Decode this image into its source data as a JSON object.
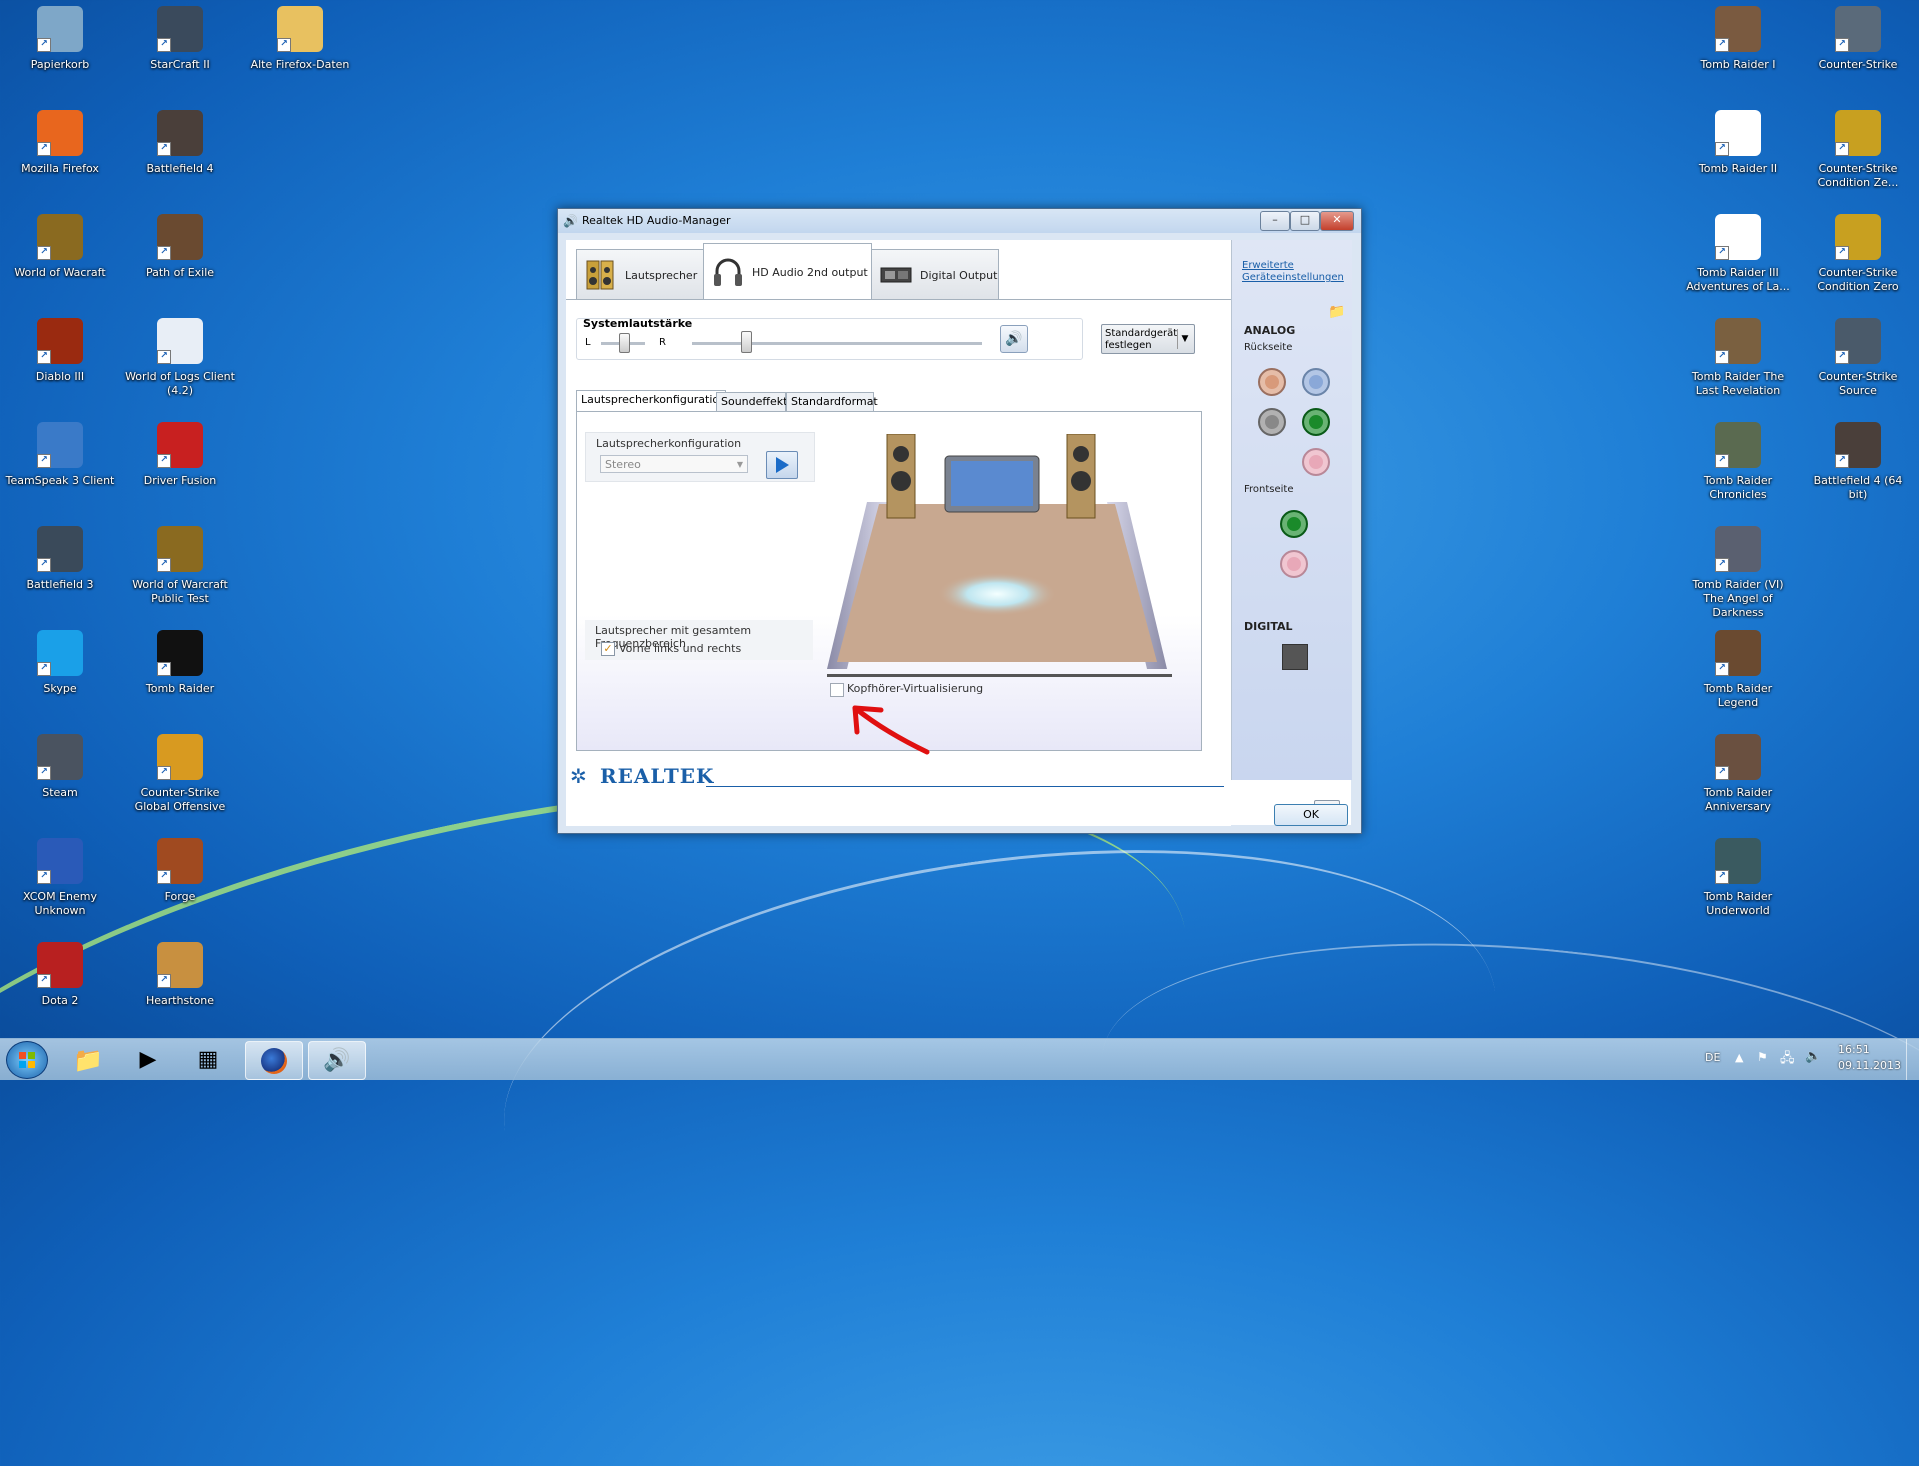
{
  "desktop": {
    "left_icons": [
      {
        "label": "Papierkorb",
        "icon": "recycle-bin-icon",
        "color": "#7ea7c8"
      },
      {
        "label": "StarCraft II",
        "icon": "starcraft-icon",
        "color": "#3a4a5c"
      },
      {
        "label": "Alte Firefox-Daten",
        "icon": "folder-icon",
        "color": "#e8c160"
      },
      {
        "label": "Mozilla Firefox",
        "icon": "firefox-icon",
        "color": "#e8661e"
      },
      {
        "label": "Battlefield 4",
        "icon": "battlefield4-icon",
        "color": "#4a3f3a"
      },
      {
        "label": "World of Wacraft",
        "icon": "warcraft-icon",
        "color": "#8a6a20"
      },
      {
        "label": "Path of Exile",
        "icon": "path-of-exile-icon",
        "color": "#6a4a30"
      },
      {
        "label": "Diablo III",
        "icon": "diablo-icon",
        "color": "#9a2a10"
      },
      {
        "label": "World of Logs Client (4.2)",
        "icon": "java-icon",
        "color": "#e8eef6"
      },
      {
        "label": "TeamSpeak 3 Client",
        "icon": "teamspeak-icon",
        "color": "#3a7ac8"
      },
      {
        "label": "Driver Fusion",
        "icon": "driver-fusion-icon",
        "color": "#c82020"
      },
      {
        "label": "Battlefield 3",
        "icon": "battlefield3-icon",
        "color": "#3a4a5a"
      },
      {
        "label": "World of Warcraft Public Test",
        "icon": "warcraft-ptr-icon",
        "color": "#8a6a20"
      },
      {
        "label": "Skype",
        "icon": "skype-icon",
        "color": "#1aa0e8"
      },
      {
        "label": "Tomb Raider",
        "icon": "tomb-raider-icon",
        "color": "#111111"
      },
      {
        "label": "Steam",
        "icon": "steam-icon",
        "color": "#4a5360"
      },
      {
        "label": "Counter-Strike Global Offensive",
        "icon": "csgo-icon",
        "color": "#d89a20"
      },
      {
        "label": "XCOM Enemy Unknown",
        "icon": "xcom-icon",
        "color": "#2a5ab8"
      },
      {
        "label": "Forge",
        "icon": "forge-icon",
        "color": "#a04a20"
      },
      {
        "label": "Dota 2",
        "icon": "dota-icon",
        "color": "#b82020"
      },
      {
        "label": "Hearthstone",
        "icon": "hearthstone-icon",
        "color": "#c89040"
      }
    ],
    "right_icons": [
      {
        "label": "Tomb Raider I",
        "icon": "tomb-raider-1-icon",
        "color": "#7a5a40"
      },
      {
        "label": "Counter-Strike",
        "icon": "counter-strike-icon",
        "color": "#5a6a7a"
      },
      {
        "label": "Tomb Raider II",
        "icon": "document-icon",
        "color": "#ffffff"
      },
      {
        "label": "Counter-Strike Condition Ze...",
        "icon": "cs-condition-zero-icon",
        "color": "#c8a020"
      },
      {
        "label": "Tomb Raider III Adventures of La...",
        "icon": "document-icon",
        "color": "#ffffff"
      },
      {
        "label": "Counter-Strike Condition Zero",
        "icon": "cs-condition-zero-icon",
        "color": "#c8a020"
      },
      {
        "label": "Tomb Raider The Last Revelation",
        "icon": "tomb-raider-lr-icon",
        "color": "#7a6040"
      },
      {
        "label": "Counter-Strike Source",
        "icon": "cs-source-icon",
        "color": "#4a5a6a"
      },
      {
        "label": "Tomb Raider Chronicles",
        "icon": "tomb-raider-chron-icon",
        "color": "#5a6a50"
      },
      {
        "label": "Battlefield 4 (64 bit)",
        "icon": "battlefield4-64-icon",
        "color": "#4a3f3a"
      },
      {
        "label": "Tomb Raider (VI) The Angel of Darkness",
        "icon": "tomb-raider-aod-icon",
        "color": "#5a6070"
      },
      {
        "label": "Tomb Raider Legend",
        "icon": "tomb-raider-legend-icon",
        "color": "#6a4a30"
      },
      {
        "label": "Tomb Raider Anniversary",
        "icon": "tomb-raider-anniv-icon",
        "color": "#6a5040"
      },
      {
        "label": "Tomb Raider Underworld",
        "icon": "tomb-raider-uw-icon",
        "color": "#3a5a60"
      }
    ]
  },
  "dialog": {
    "title": "Realtek HD Audio-Manager",
    "tabs": [
      {
        "label": "Lautsprecher",
        "icon": "speakers-icon"
      },
      {
        "label": "HD Audio 2nd output",
        "icon": "headphones-icon"
      },
      {
        "label": "Digital Output",
        "icon": "digital-output-icon"
      }
    ],
    "advanced_link": "Erweiterte Geräteeinstellungen",
    "volume": {
      "label": "Systemlautstärke",
      "left": "L",
      "right": "R",
      "balance": 0.5,
      "level": 0.18
    },
    "default_device_button": "Standardgerät festlegen",
    "subtabs": [
      "Lautsprecherkonfiguration",
      "Soundeffekt",
      "Standardformat"
    ],
    "speaker_config": {
      "group_label": "Lautsprecherkonfiguration",
      "select_value": "Stereo",
      "fullrange_label": "Lautsprecher mit gesamtem Frequenzbereich",
      "fullrange_checkbox": "Vorne links und rechts",
      "fullrange_checked": true,
      "virtualization_label": "Kopfhörer-Virtualisierung",
      "virtualization_checked": false
    },
    "side": {
      "analog": "ANALOG",
      "back": "Rückseite",
      "front": "Frontseite",
      "digital": "DIGITAL"
    },
    "brand": "REALTEK",
    "ok_button": "OK"
  },
  "taskbar": {
    "language": "DE",
    "time": "16:51",
    "date": "09.11.2013"
  }
}
